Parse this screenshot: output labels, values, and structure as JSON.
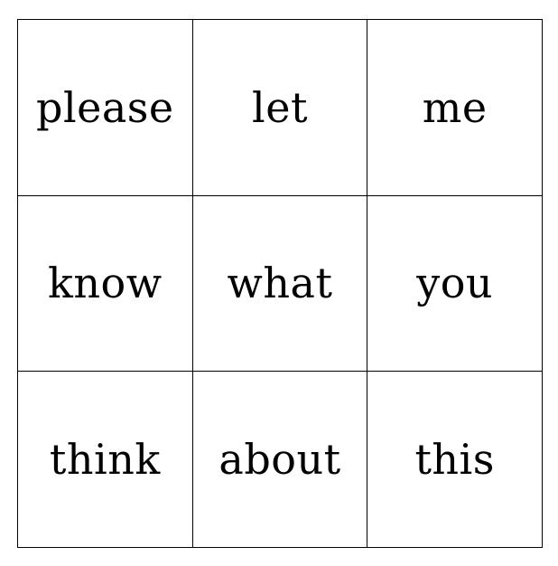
{
  "grid": {
    "cells": [
      "please",
      "let",
      "me",
      "know",
      "what",
      "you",
      "think",
      "about",
      "this"
    ]
  }
}
